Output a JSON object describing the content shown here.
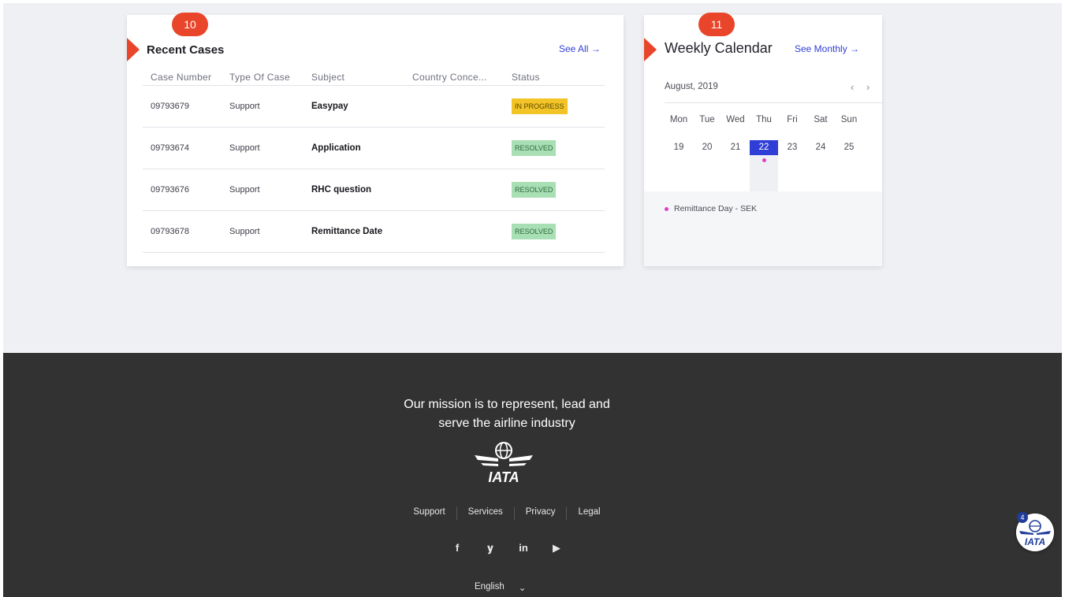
{
  "colors": {
    "accent_red": "#e8452a",
    "link_blue": "#2f3fd6",
    "in_progress": "#f2c427",
    "resolved": "#a9dfb5",
    "footer_bg": "#323232",
    "event_dot": "#e03ecf"
  },
  "cases": {
    "marker": "10",
    "title": "Recent Cases",
    "see_all": "See All →",
    "columns": [
      "Case Number",
      "Type Of Case",
      "Subject",
      "Country Conce...",
      "Status"
    ],
    "rows": [
      {
        "number": "09793679",
        "type": "Support",
        "subject": "Easypay",
        "country": "",
        "status": "IN PROGRESS"
      },
      {
        "number": "09793674",
        "type": "Support",
        "subject": "Application",
        "country": "",
        "status": "RESOLVED"
      },
      {
        "number": "09793676",
        "type": "Support",
        "subject": "RHC question",
        "country": "",
        "status": "RESOLVED"
      },
      {
        "number": "09793678",
        "type": "Support",
        "subject": "Remittance Date",
        "country": "",
        "status": "RESOLVED"
      }
    ]
  },
  "calendar": {
    "marker": "11",
    "title": "Weekly Calendar",
    "see_monthly": "See Monthly →",
    "month": "August, 2019",
    "prev": "‹",
    "next": "›",
    "weekdays": [
      "Mon",
      "Tue",
      "Wed",
      "Thu",
      "Fri",
      "Sat",
      "Sun"
    ],
    "days": [
      "19",
      "20",
      "21",
      "22",
      "23",
      "24",
      "25"
    ],
    "today": "22",
    "events": [
      {
        "label": "Remittance Day - SEK"
      }
    ]
  },
  "footer": {
    "mission_line1": "Our mission is to represent, lead and",
    "mission_line2": "serve the airline industry",
    "logo_text": "IATA",
    "links": [
      "Support",
      "Services",
      "Privacy",
      "Legal"
    ],
    "social": [
      "f",
      "𝐲",
      "in",
      "▶"
    ],
    "language": "English",
    "language_chevron": "⌄"
  },
  "chat": {
    "badge": "4",
    "logo_text": "IATA"
  }
}
